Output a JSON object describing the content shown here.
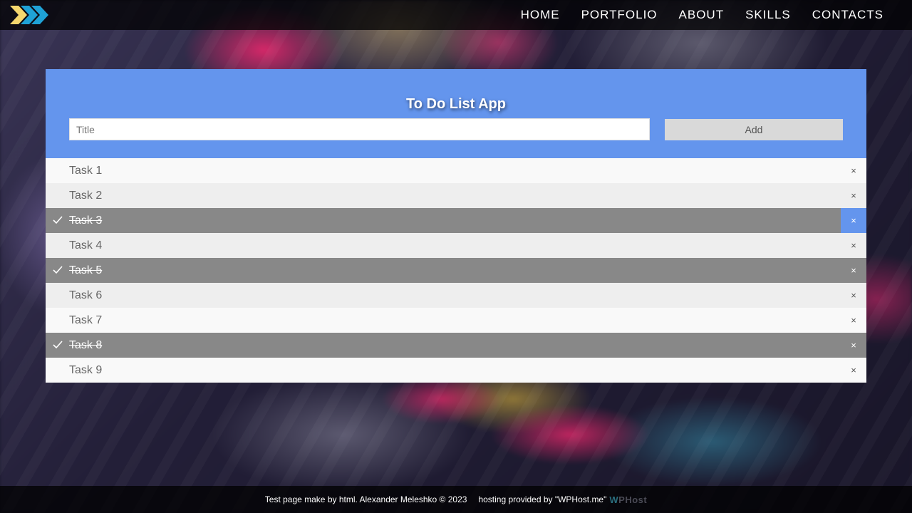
{
  "nav": {
    "items": [
      {
        "label": "HOME"
      },
      {
        "label": "PORTFOLIO"
      },
      {
        "label": "ABOUT"
      },
      {
        "label": "SKILLS"
      },
      {
        "label": "CONTACTS"
      }
    ]
  },
  "app": {
    "title": "To Do List App",
    "input": {
      "placeholder": "Title",
      "value": ""
    },
    "add_label": "Add",
    "tasks": [
      {
        "label": "Task 1",
        "checked": false
      },
      {
        "label": "Task 2",
        "checked": false
      },
      {
        "label": "Task 3",
        "checked": true
      },
      {
        "label": "Task 4",
        "checked": false
      },
      {
        "label": "Task 5",
        "checked": true
      },
      {
        "label": "Task 6",
        "checked": false
      },
      {
        "label": "Task 7",
        "checked": false
      },
      {
        "label": "Task 8",
        "checked": true
      },
      {
        "label": "Task 9",
        "checked": false
      }
    ],
    "close_glyph": "×",
    "hovered_close_task": "Task 3"
  },
  "footer": {
    "credit": "Test page make by html. Alexander Meleshko © 2023",
    "hosting": "hosting provided by \"WPHost.me\"",
    "hosting_logo": "WPHost"
  },
  "colors": {
    "accent": "#6495ed",
    "checked_row": "#888888",
    "logo_yellow": "#f5d76e",
    "logo_blue": "#1fa2d6"
  }
}
